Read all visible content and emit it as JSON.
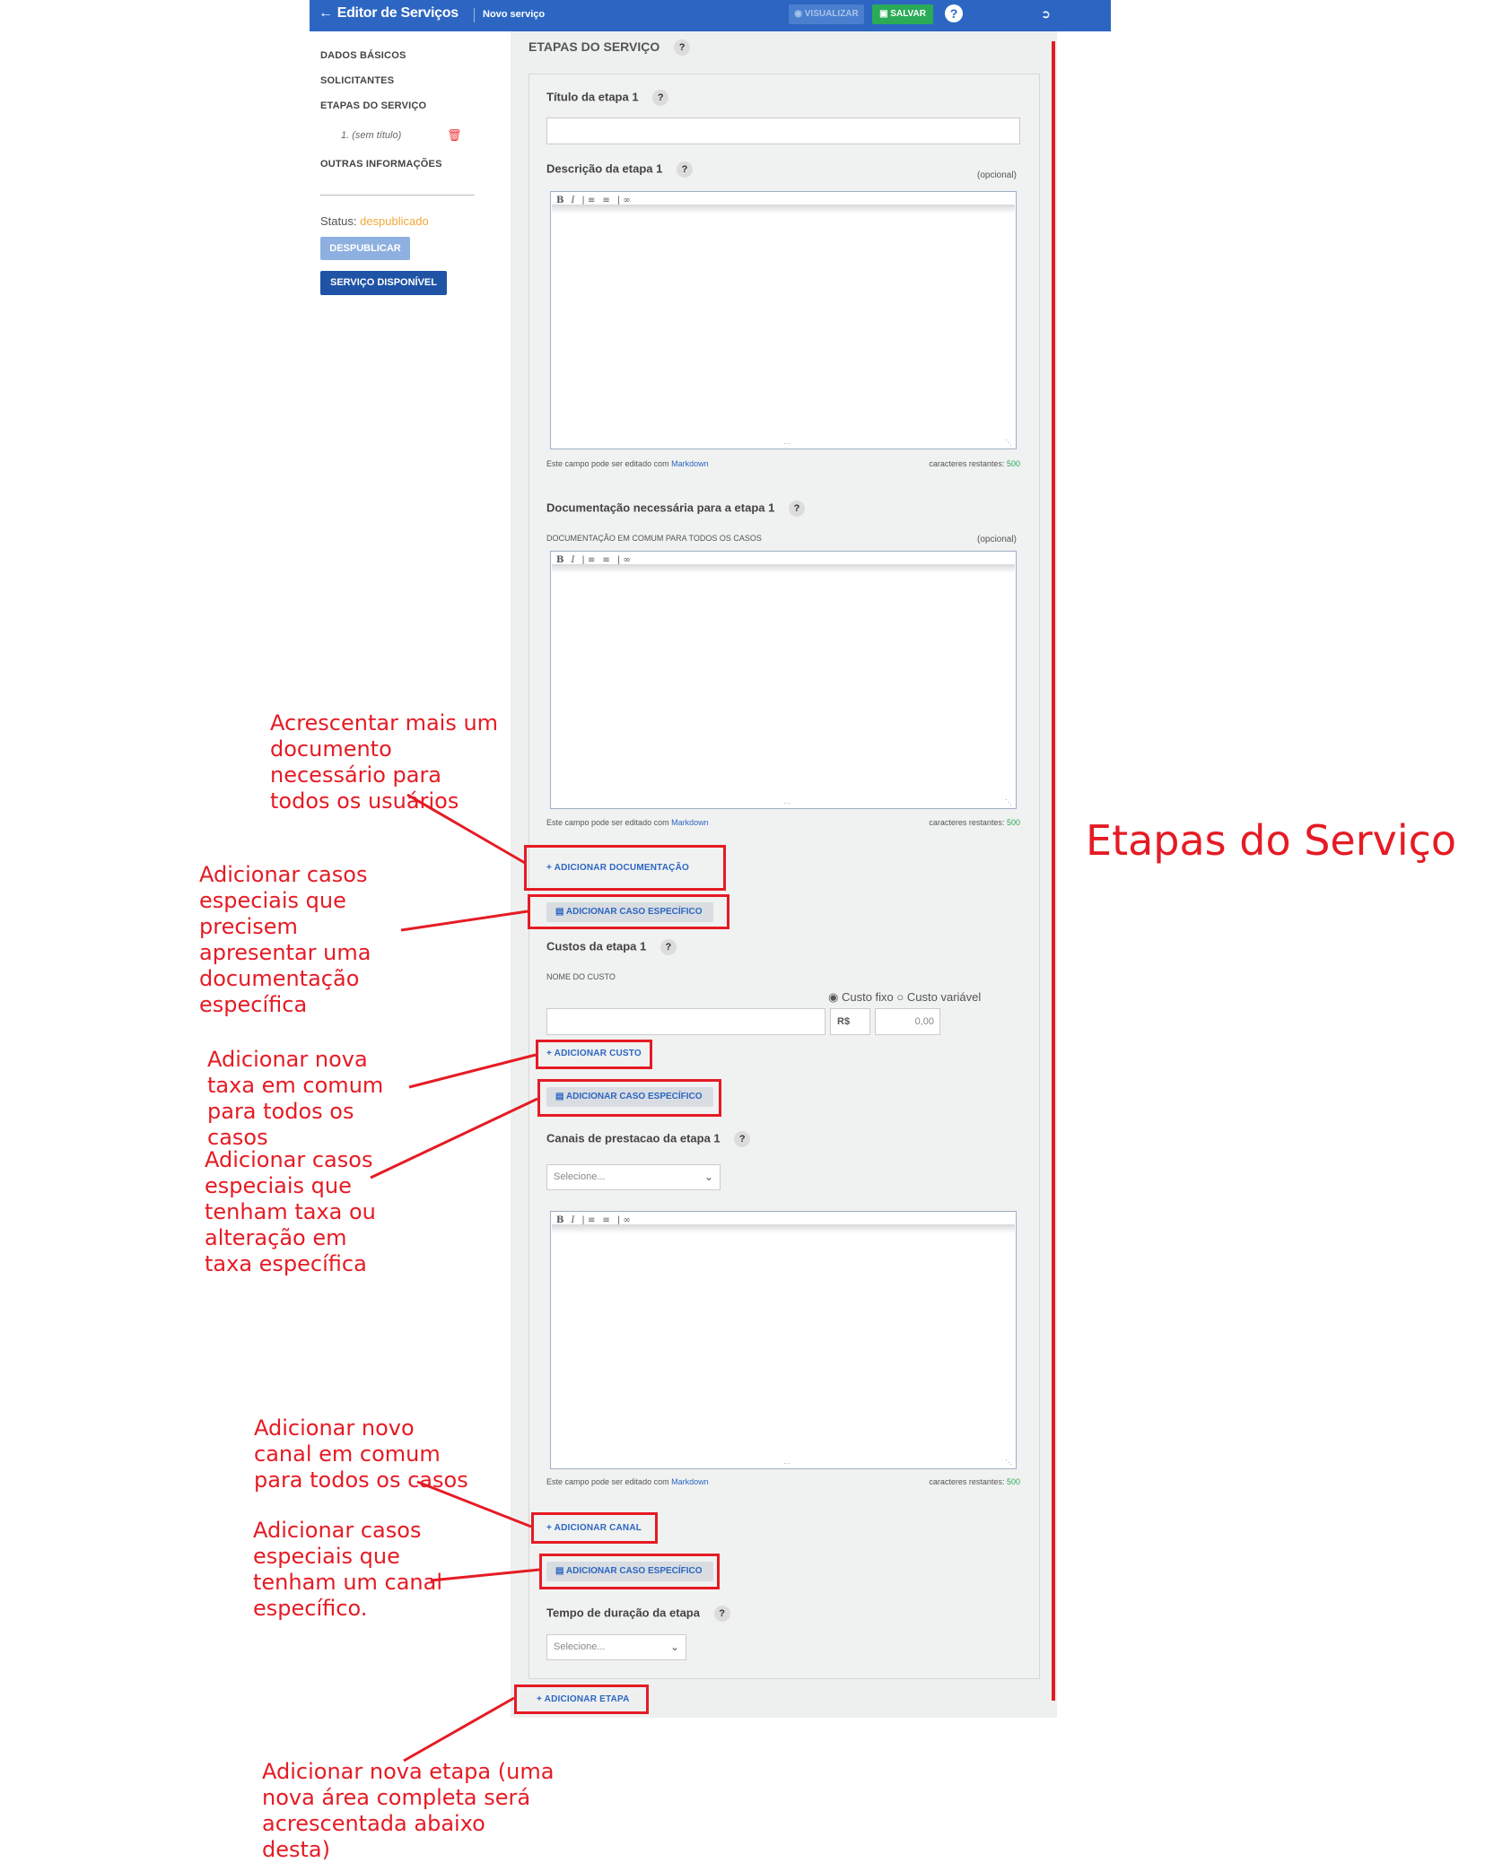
{
  "topbar": {
    "back_icon": "arrow-left-icon",
    "title": "Editor de Serviços",
    "subtitle": "Novo serviço",
    "visualizar": "VISUALIZAR",
    "salvar": "SALVAR",
    "help": "?"
  },
  "sidebar": {
    "items": [
      "DADOS BÁSICOS",
      "SOLICITANTES",
      "ETAPAS DO SERVIÇO",
      "OUTRAS INFORMAÇÕES"
    ],
    "sub_item": "1. (sem título)",
    "status_label": "Status:",
    "status_value": "despublicado",
    "despublicar": "DESPUBLICAR",
    "servico_disponivel": "SERVIÇO DISPONÍVEL"
  },
  "main": {
    "section_title": "ETAPAS DO SERVIÇO",
    "help": "?",
    "titulo_label": "Título da etapa 1",
    "descricao_label": "Descrição da etapa 1",
    "opcional": "(opcional)",
    "markdown_hint": "Este campo pode ser editado com",
    "markdown_link": "Markdown",
    "chars_label": "caracteres restantes:",
    "chars_count": "500",
    "doc_label": "Documentação necessária para a etapa 1",
    "doc_common": "DOCUMENTAÇÃO EM COMUM PARA TODOS OS CASOS",
    "add_doc": "+ ADICIONAR DOCUMENTAÇÃO",
    "add_case": "ADICIONAR CASO ESPECÍFICO",
    "custos_label": "Custos da etapa 1",
    "nome_custo": "NOME DO CUSTO",
    "custo_fixo": "Custo fixo",
    "custo_variavel": "Custo variável",
    "currency": "R$",
    "cost_placeholder": "0,00",
    "add_custo": "+ ADICIONAR CUSTO",
    "canais_label": "Canais de prestacao da etapa 1",
    "selecione": "Selecione...",
    "add_canal": "+ ADICIONAR CANAL",
    "tempo_label": "Tempo de duração da etapa",
    "add_etapa": "+ ADICIONAR ETAPA"
  },
  "annotations": {
    "title": "Etapas do Serviço",
    "doc_all": "Acrescentar mais um documento necessário para todos os usuários",
    "doc_case": "Adicionar casos especiais que precisem apresentar uma documentação específica",
    "taxa_all": "Adicionar nova taxa em comum para todos os casos",
    "taxa_case": "Adicionar casos especiais que tenham taxa ou alteração em taxa específica",
    "canal_all": "Adicionar novo canal em comum para todos os casos",
    "canal_case": "Adicionar casos especiais que tenham um canal específico.",
    "etapa": "Adicionar nova etapa (uma nova área completa será acrescentada abaixo desta)"
  },
  "colors": {
    "topbar": "#2c66c2",
    "annotation": "#e51b24",
    "status": "#f0a93a",
    "save": "#2bab57"
  }
}
